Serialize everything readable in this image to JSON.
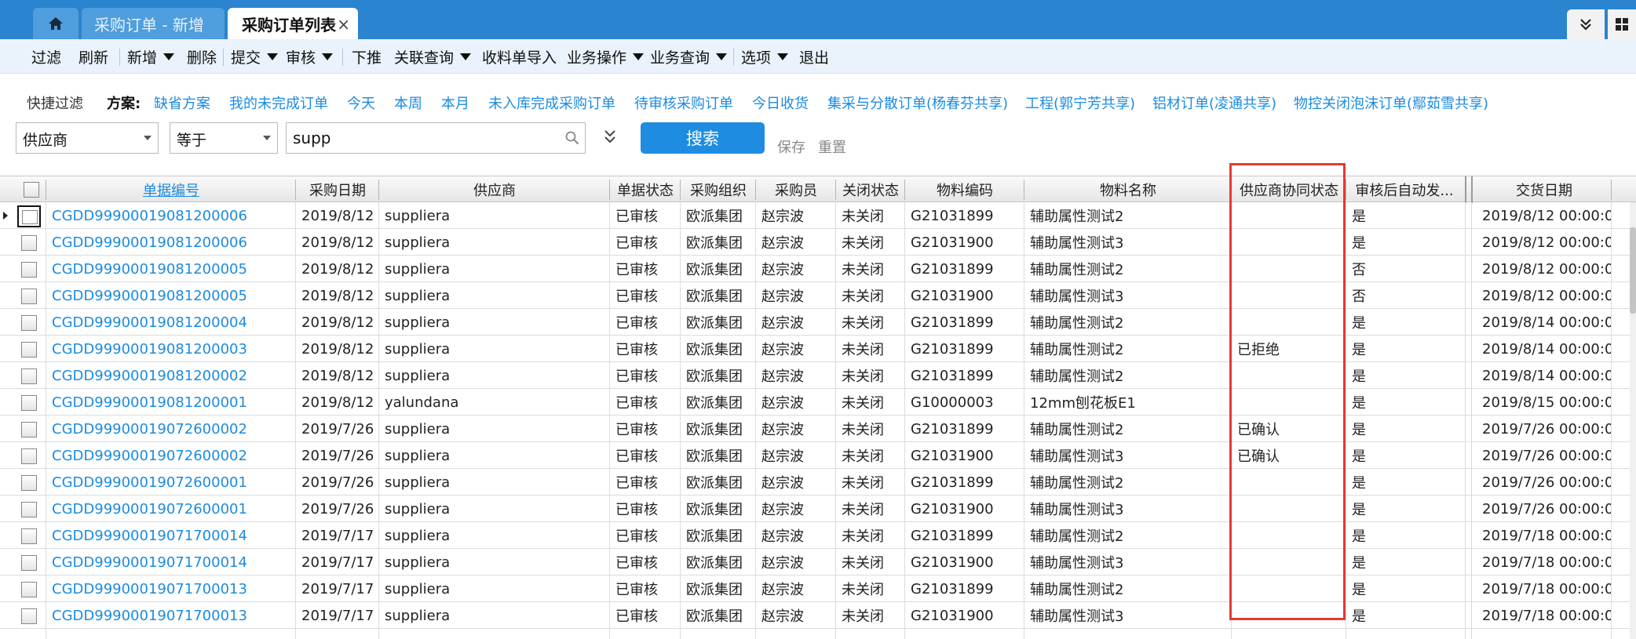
{
  "tabs": [
    {
      "label": "采购订单 - 新增"
    },
    {
      "label": "采购订单列表"
    }
  ],
  "menu": {
    "filter": "过滤",
    "refresh": "刷新",
    "add": "新增",
    "delete": "删除",
    "submit": "提交",
    "audit": "审核",
    "push": "下推",
    "related_query": "关联查询",
    "receipt_import": "收料单导入",
    "business_ops": "业务操作",
    "business_query": "业务查询",
    "options": "选项",
    "exit": "退出"
  },
  "quick_filter": {
    "label": "快捷过滤",
    "scheme_label": "方案:",
    "schemes": [
      "缺省方案",
      "我的未完成订单",
      "今天",
      "本周",
      "本月",
      "未入库完成采购订单",
      "待审核采购订单",
      "今日收货",
      "集采与分散订单(杨春芬共享)",
      "工程(郭宁芳共享)",
      "铝材订单(凌通共享)",
      "物控关闭泡沫订单(鄢茹雪共享)"
    ],
    "field_select": "供应商",
    "operator_select": "等于",
    "search_value": "supp",
    "search_button": "搜索",
    "save_link": "保存",
    "reset_link": "重置"
  },
  "columns": [
    "单据编号",
    "采购日期",
    "供应商",
    "单据状态",
    "采购组织",
    "采购员",
    "关闭状态",
    "物料编码",
    "物料名称",
    "供应商协同状态",
    "审核后自动发...",
    "交货日期"
  ],
  "rows": [
    [
      "CGDD99900019081200006",
      "2019/8/12",
      "suppliera",
      "已审核",
      "欧派集团",
      "赵宗波",
      "未关闭",
      "G21031899",
      "辅助属性测试2",
      "",
      "是",
      "2019/8/12 00:00:0"
    ],
    [
      "CGDD99900019081200006",
      "2019/8/12",
      "suppliera",
      "已审核",
      "欧派集团",
      "赵宗波",
      "未关闭",
      "G21031900",
      "辅助属性测试3",
      "",
      "是",
      "2019/8/12 00:00:0"
    ],
    [
      "CGDD99900019081200005",
      "2019/8/12",
      "suppliera",
      "已审核",
      "欧派集团",
      "赵宗波",
      "未关闭",
      "G21031899",
      "辅助属性测试2",
      "",
      "否",
      "2019/8/12 00:00:0"
    ],
    [
      "CGDD99900019081200005",
      "2019/8/12",
      "suppliera",
      "已审核",
      "欧派集团",
      "赵宗波",
      "未关闭",
      "G21031900",
      "辅助属性测试3",
      "",
      "否",
      "2019/8/12 00:00:0"
    ],
    [
      "CGDD99900019081200004",
      "2019/8/12",
      "suppliera",
      "已审核",
      "欧派集团",
      "赵宗波",
      "未关闭",
      "G21031899",
      "辅助属性测试2",
      "",
      "是",
      "2019/8/14 00:00:0"
    ],
    [
      "CGDD99900019081200003",
      "2019/8/12",
      "suppliera",
      "已审核",
      "欧派集团",
      "赵宗波",
      "未关闭",
      "G21031899",
      "辅助属性测试2",
      "已拒绝",
      "是",
      "2019/8/14 00:00:0"
    ],
    [
      "CGDD99900019081200002",
      "2019/8/12",
      "suppliera",
      "已审核",
      "欧派集团",
      "赵宗波",
      "未关闭",
      "G21031899",
      "辅助属性测试2",
      "",
      "是",
      "2019/8/14 00:00:0"
    ],
    [
      "CGDD99900019081200001",
      "2019/8/12",
      "yalundana",
      "已审核",
      "欧派集团",
      "赵宗波",
      "未关闭",
      "G10000003",
      "12mm刨花板E1",
      "",
      "是",
      "2019/8/15 00:00:0"
    ],
    [
      "CGDD99900019072600002",
      "2019/7/26",
      "suppliera",
      "已审核",
      "欧派集团",
      "赵宗波",
      "未关闭",
      "G21031899",
      "辅助属性测试2",
      "已确认",
      "是",
      "2019/7/26 00:00:0"
    ],
    [
      "CGDD99900019072600002",
      "2019/7/26",
      "suppliera",
      "已审核",
      "欧派集团",
      "赵宗波",
      "未关闭",
      "G21031900",
      "辅助属性测试3",
      "已确认",
      "是",
      "2019/7/26 00:00:0"
    ],
    [
      "CGDD99900019072600001",
      "2019/7/26",
      "suppliera",
      "已审核",
      "欧派集团",
      "赵宗波",
      "未关闭",
      "G21031899",
      "辅助属性测试2",
      "",
      "是",
      "2019/7/26 00:00:0"
    ],
    [
      "CGDD99900019072600001",
      "2019/7/26",
      "suppliera",
      "已审核",
      "欧派集团",
      "赵宗波",
      "未关闭",
      "G21031900",
      "辅助属性测试3",
      "",
      "是",
      "2019/7/26 00:00:0"
    ],
    [
      "CGDD99900019071700014",
      "2019/7/17",
      "suppliera",
      "已审核",
      "欧派集团",
      "赵宗波",
      "未关闭",
      "G21031899",
      "辅助属性测试2",
      "",
      "是",
      "2019/7/18 00:00:0"
    ],
    [
      "CGDD99900019071700014",
      "2019/7/17",
      "suppliera",
      "已审核",
      "欧派集团",
      "赵宗波",
      "未关闭",
      "G21031900",
      "辅助属性测试3",
      "",
      "是",
      "2019/7/18 00:00:0"
    ],
    [
      "CGDD99900019071700013",
      "2019/7/17",
      "suppliera",
      "已审核",
      "欧派集团",
      "赵宗波",
      "未关闭",
      "G21031899",
      "辅助属性测试2",
      "",
      "是",
      "2019/7/18 00:00:0"
    ],
    [
      "CGDD99900019071700013",
      "2019/7/17",
      "suppliera",
      "已审核",
      "欧派集团",
      "赵宗波",
      "未关闭",
      "G21031900",
      "辅助属性测试3",
      "",
      "是",
      "2019/7/18 00:00:0"
    ]
  ],
  "colors": {
    "tabbar": "#2a84cf",
    "link": "#1c8be0",
    "search_button": "#1e8de1",
    "highlight_box": "#e53935"
  },
  "icons": [
    "home-icon",
    "close-icon",
    "collapse-icon",
    "grid-icon",
    "search-icon",
    "expand-icon",
    "dropdown-caret-icon"
  ]
}
